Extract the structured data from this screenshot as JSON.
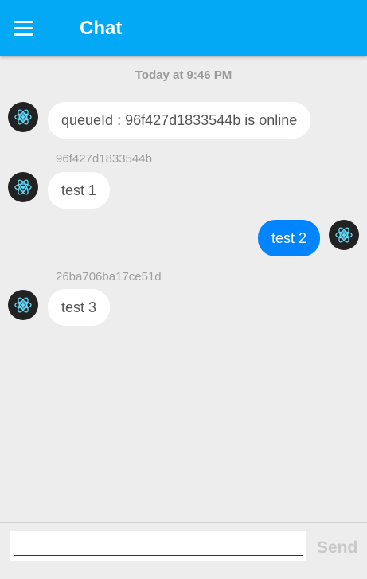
{
  "header": {
    "title": "Chat",
    "menu_icon": "hamburger-icon",
    "color": "#03a9f4"
  },
  "chat": {
    "timestamp": "Today at 9:46 PM",
    "messages": [
      {
        "sender": "",
        "text": "queueId : 96f427d1833544b is online",
        "direction": "incoming"
      },
      {
        "sender": "96f427d1833544b",
        "text": "test 1",
        "direction": "incoming"
      },
      {
        "sender": "",
        "text": "test 2",
        "direction": "outgoing"
      },
      {
        "sender": "26ba706ba17ce51d",
        "text": "test 3",
        "direction": "incoming"
      }
    ],
    "avatar_icon": "react-atom-icon",
    "outgoing_color": "#0084ff"
  },
  "composer": {
    "placeholder": "",
    "value": "",
    "send_label": "Send"
  }
}
